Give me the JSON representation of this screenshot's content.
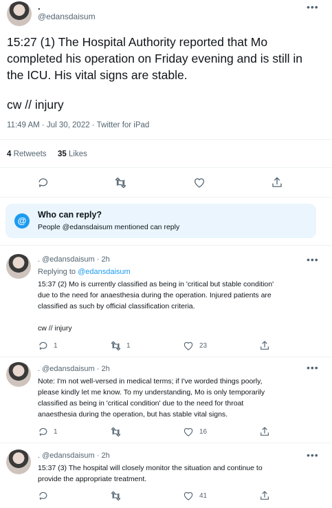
{
  "main_tweet": {
    "display_name": ".",
    "handle": "@edansdaisum",
    "text_lines": [
      "15:27 (1) The Hospital Authority reported that Mo",
      "completed his operation on Friday evening and is still in",
      "the ICU. His vital signs are stable."
    ],
    "text_tail": "cw // injury",
    "meta": "11:49 AM · Jul 30, 2022 · Twitter for iPad",
    "retweets_count": "4",
    "retweets_label": "Retweets",
    "likes_count": "35",
    "likes_label": "Likes"
  },
  "who_can_reply": {
    "title": "Who can reply?",
    "subtitle": "People @edansdaisum mentioned can reply"
  },
  "replies": [
    {
      "name_handle_time": ". @edansdaisum · 2h",
      "replying_prefix": "Replying to ",
      "replying_handle": "@edansdaisum",
      "lines": [
        "15:37 (2) Mo is currently classified as being in 'critical but stable condition'",
        "due to the need for anaesthesia during the operation. Injured patients are",
        "classified as such by official classification criteria."
      ],
      "tail": "cw // injury",
      "reply_count": "1",
      "retweet_count": "1",
      "like_count": "23"
    },
    {
      "name_handle_time": ". @edansdaisum · 2h",
      "lines": [
        "Note: I'm not well-versed in medical terms; if I've worded things poorly,",
        "please kindly let me know. To my understanding, Mo is only temporarily",
        "classified as being in 'critical condition' due to the need for throat",
        "anaesthesia during the operation, but has stable vital signs."
      ],
      "reply_count": "1",
      "like_count": "16"
    },
    {
      "name_handle_time": ". @edansdaisum · 2h",
      "lines": [
        "15:37 (3)  The hospital will closely monitor the situation and continue to",
        "provide the appropriate treatment."
      ],
      "like_count": "41"
    }
  ],
  "colors": {
    "accent": "#1d9bf0",
    "muted": "#536471",
    "info_bg": "#eaf5fd"
  }
}
